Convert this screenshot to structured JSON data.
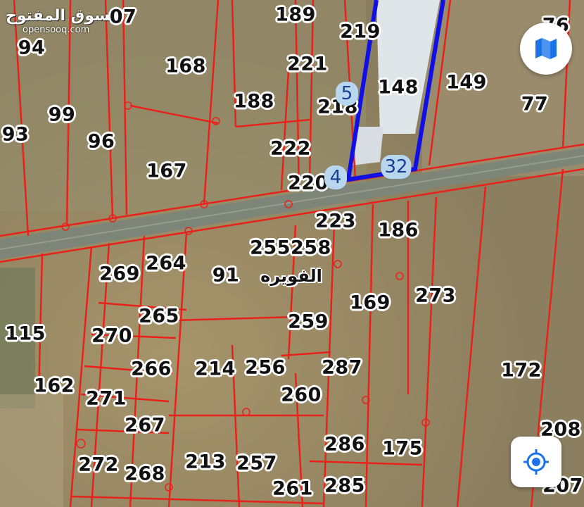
{
  "branding": {
    "logo_text_ar": "السوق المفتوح",
    "logo_text_en": "opensooq.com"
  },
  "place_name": "الفويره",
  "parcels": [
    {
      "id": "07"
    },
    {
      "id": "94"
    },
    {
      "id": "189"
    },
    {
      "id": "219"
    },
    {
      "id": "76"
    },
    {
      "id": "168"
    },
    {
      "id": "221"
    },
    {
      "id": "148"
    },
    {
      "id": "149"
    },
    {
      "id": "188"
    },
    {
      "id": "218"
    },
    {
      "id": "77"
    },
    {
      "id": "99"
    },
    {
      "id": "93"
    },
    {
      "id": "96"
    },
    {
      "id": "222"
    },
    {
      "id": "167"
    },
    {
      "id": "220"
    },
    {
      "id": "223"
    },
    {
      "id": "186"
    },
    {
      "id": "255258"
    },
    {
      "id": "269"
    },
    {
      "id": "264"
    },
    {
      "id": "91"
    },
    {
      "id": "169"
    },
    {
      "id": "273"
    },
    {
      "id": "265"
    },
    {
      "id": "259"
    },
    {
      "id": "115"
    },
    {
      "id": "270"
    },
    {
      "id": "266"
    },
    {
      "id": "214"
    },
    {
      "id": "256"
    },
    {
      "id": "287"
    },
    {
      "id": "172"
    },
    {
      "id": "162"
    },
    {
      "id": "271"
    },
    {
      "id": "260"
    },
    {
      "id": "267"
    },
    {
      "id": "208"
    },
    {
      "id": "286"
    },
    {
      "id": "175"
    },
    {
      "id": "272"
    },
    {
      "id": "213"
    },
    {
      "id": "257"
    },
    {
      "id": "268"
    },
    {
      "id": "261"
    },
    {
      "id": "285"
    },
    {
      "id": "207"
    }
  ],
  "markers": [
    {
      "label": "5"
    },
    {
      "label": "4"
    },
    {
      "label": "32"
    }
  ],
  "colors": {
    "parcel_line": "#e8221a",
    "selection": "#1010e6",
    "road": "#7d8478",
    "terrain": "#9b8c6a",
    "greenhouse": "#dfe6ea",
    "button_icon": "#1a73e8"
  },
  "controls": {
    "layers_icon": "map-layers-icon",
    "locate_icon": "my-location-icon"
  }
}
